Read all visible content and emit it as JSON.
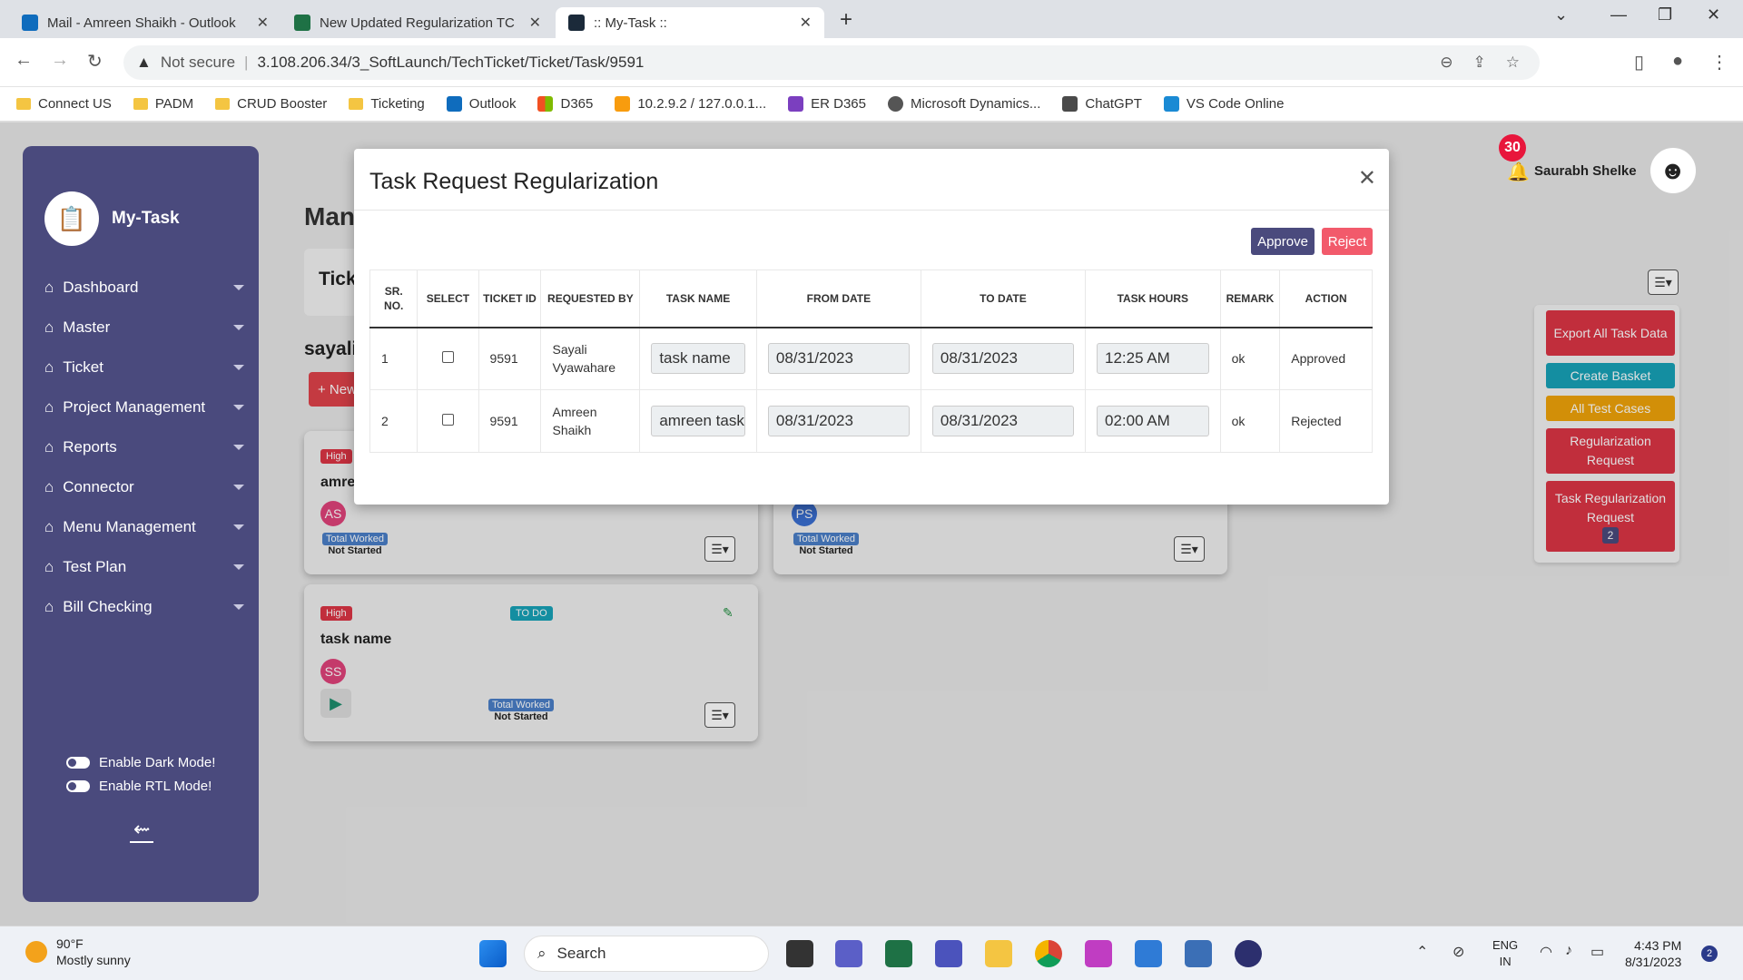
{
  "browser": {
    "tabs": [
      {
        "title": "Mail - Amreen Shaikh - Outlook",
        "color": "#0f6cbd"
      },
      {
        "title": "New Updated Regularization TC",
        "color": "#1e7145"
      },
      {
        "title": ":: My-Task ::",
        "color": "#1b2a3a"
      }
    ],
    "not_secure": "Not secure",
    "url": "3.108.206.34/3_SoftLaunch/TechTicket/Ticket/Task/9591",
    "bookmarks": [
      {
        "label": "Connect US",
        "icon": "folder-icon"
      },
      {
        "label": "PADM",
        "icon": "folder-icon"
      },
      {
        "label": "CRUD Booster",
        "icon": "folder-icon"
      },
      {
        "label": "Ticketing",
        "icon": "folder-icon"
      },
      {
        "label": "Outlook",
        "icon": "outlook-icon"
      },
      {
        "label": "D365",
        "icon": "microsoft-icon"
      },
      {
        "label": "10.2.9.2 / 127.0.0.1...",
        "icon": "phpmyadmin-icon"
      },
      {
        "label": "ER D365",
        "icon": "er-icon"
      },
      {
        "label": "Microsoft Dynamics...",
        "icon": "globe-icon"
      },
      {
        "label": "ChatGPT",
        "icon": "chatgpt-icon"
      },
      {
        "label": "VS Code Online",
        "icon": "vscode-icon"
      }
    ]
  },
  "sidebar": {
    "brand": "My-Task",
    "items": [
      {
        "label": "Dashboard"
      },
      {
        "label": "Master"
      },
      {
        "label": "Ticket"
      },
      {
        "label": "Project Management"
      },
      {
        "label": "Reports"
      },
      {
        "label": "Connector"
      },
      {
        "label": "Menu Management"
      },
      {
        "label": "Test Plan"
      },
      {
        "label": "Bill Checking"
      }
    ],
    "dark_mode": "Enable Dark Mode!",
    "rtl_mode": "Enable RTL Mode!"
  },
  "header": {
    "notification_count": "30",
    "user_name": "Saurabh Shelke"
  },
  "background": {
    "page_title_partial": "Man",
    "card_title_partial": "Tick",
    "section_partial": "sayali",
    "new_button": "+ New",
    "card1": {
      "priority": "High",
      "title_partial": "amre",
      "avatar": "AS",
      "total_worked": "Total Worked",
      "status": "Not Started"
    },
    "card2": {
      "avatar_partial": "PS",
      "total_worked": "Total Worked",
      "status": "Not Started"
    },
    "card3": {
      "priority": "High",
      "state": "TO DO",
      "title": "task name",
      "avatar": "SS",
      "total_worked": "Total Worked",
      "status": "Not Started"
    }
  },
  "right_panel": {
    "buttons": [
      {
        "label": "Export All Task Data",
        "color": "#dc3545"
      },
      {
        "label": "Create Basket",
        "color": "#17a2b8"
      },
      {
        "label": "All Test Cases",
        "color": "#f0a30a"
      },
      {
        "label": "Regularization Request",
        "color": "#dc3545"
      },
      {
        "label": "Task Regularization Request",
        "color": "#dc3545",
        "badge": "2"
      }
    ]
  },
  "modal": {
    "title": "Task Request Regularization",
    "approve": "Approve",
    "reject": "Reject",
    "columns": [
      "SR. NO.",
      "SELECT",
      "TICKET ID",
      "REQUESTED BY",
      "TASK NAME",
      "FROM DATE",
      "TO DATE",
      "TASK HOURS",
      "REMARK",
      "ACTION"
    ],
    "rows": [
      {
        "sr": "1",
        "ticket_id": "9591",
        "requested_by": "Sayali Vyawahare",
        "task_name": "task name",
        "from_date": "08/31/2023",
        "to_date": "08/31/2023",
        "task_hours": "12:25 AM",
        "remark": "ok",
        "action": "Approved"
      },
      {
        "sr": "2",
        "ticket_id": "9591",
        "requested_by": "Amreen Shaikh",
        "task_name": "amreen task",
        "from_date": "08/31/2023",
        "to_date": "08/31/2023",
        "task_hours": "02:00 AM",
        "remark": "ok",
        "action": "Rejected"
      }
    ]
  },
  "taskbar": {
    "temp": "90°F",
    "weather": "Mostly sunny",
    "search": "Search",
    "lang1": "ENG",
    "lang2": "IN",
    "time": "4:43 PM",
    "date": "8/31/2023",
    "notif": "2"
  }
}
